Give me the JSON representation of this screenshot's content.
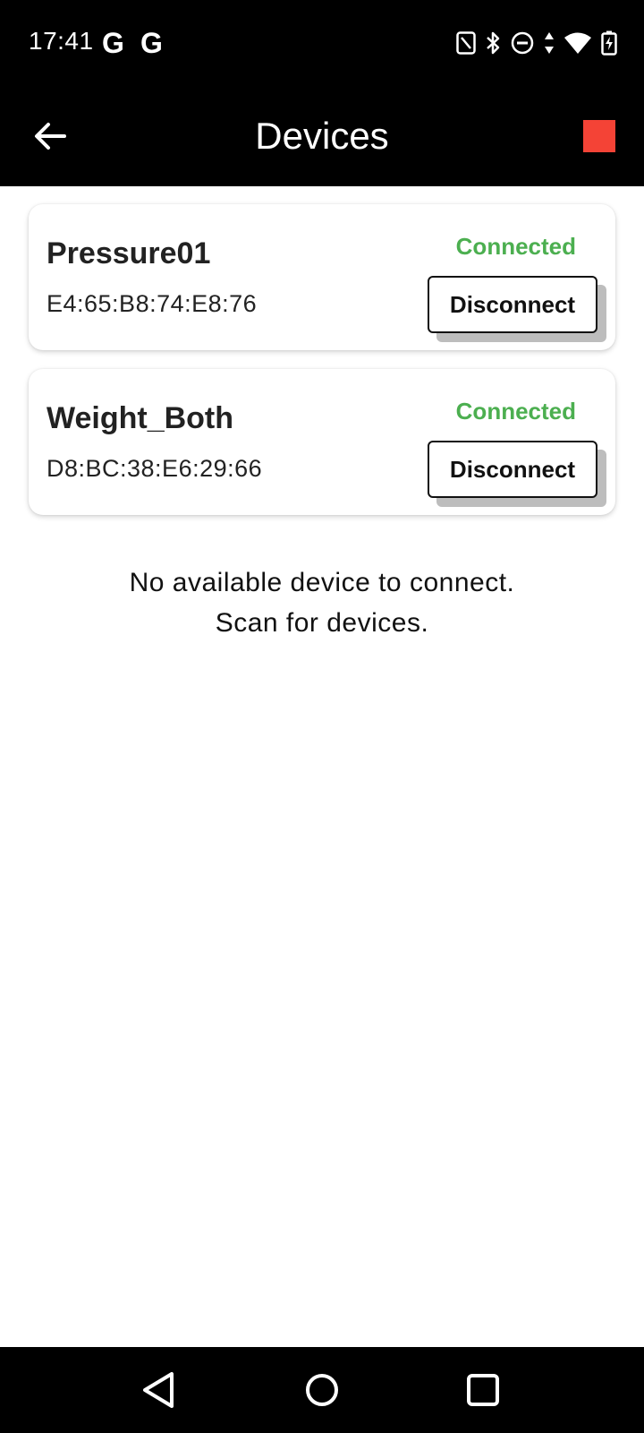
{
  "status_bar": {
    "time": "17:41",
    "notification_icons": [
      "G",
      "G"
    ],
    "system_icons": [
      "nfc-icon",
      "bluetooth-icon",
      "do-not-disturb-icon",
      "data-arrows-icon",
      "wifi-icon",
      "battery-charging-icon"
    ]
  },
  "app_bar": {
    "title": "Devices",
    "back_icon": "arrow-left-icon",
    "stop_icon": "stop-icon",
    "stop_color": "#f44336"
  },
  "devices": [
    {
      "name": "Pressure01",
      "address": "E4:65:B8:74:E8:76",
      "status": "Connected",
      "action_label": "Disconnect"
    },
    {
      "name": "Weight_Both",
      "address": "D8:BC:38:E6:29:66",
      "status": "Connected",
      "action_label": "Disconnect"
    }
  ],
  "empty_state": {
    "line1": "No available device to connect.",
    "line2": "Scan for devices."
  },
  "colors": {
    "status_connected": "#4caf50",
    "bars": "#000000"
  },
  "nav_bar": {
    "icons": [
      "nav-back-icon",
      "nav-home-icon",
      "nav-recents-icon"
    ]
  }
}
